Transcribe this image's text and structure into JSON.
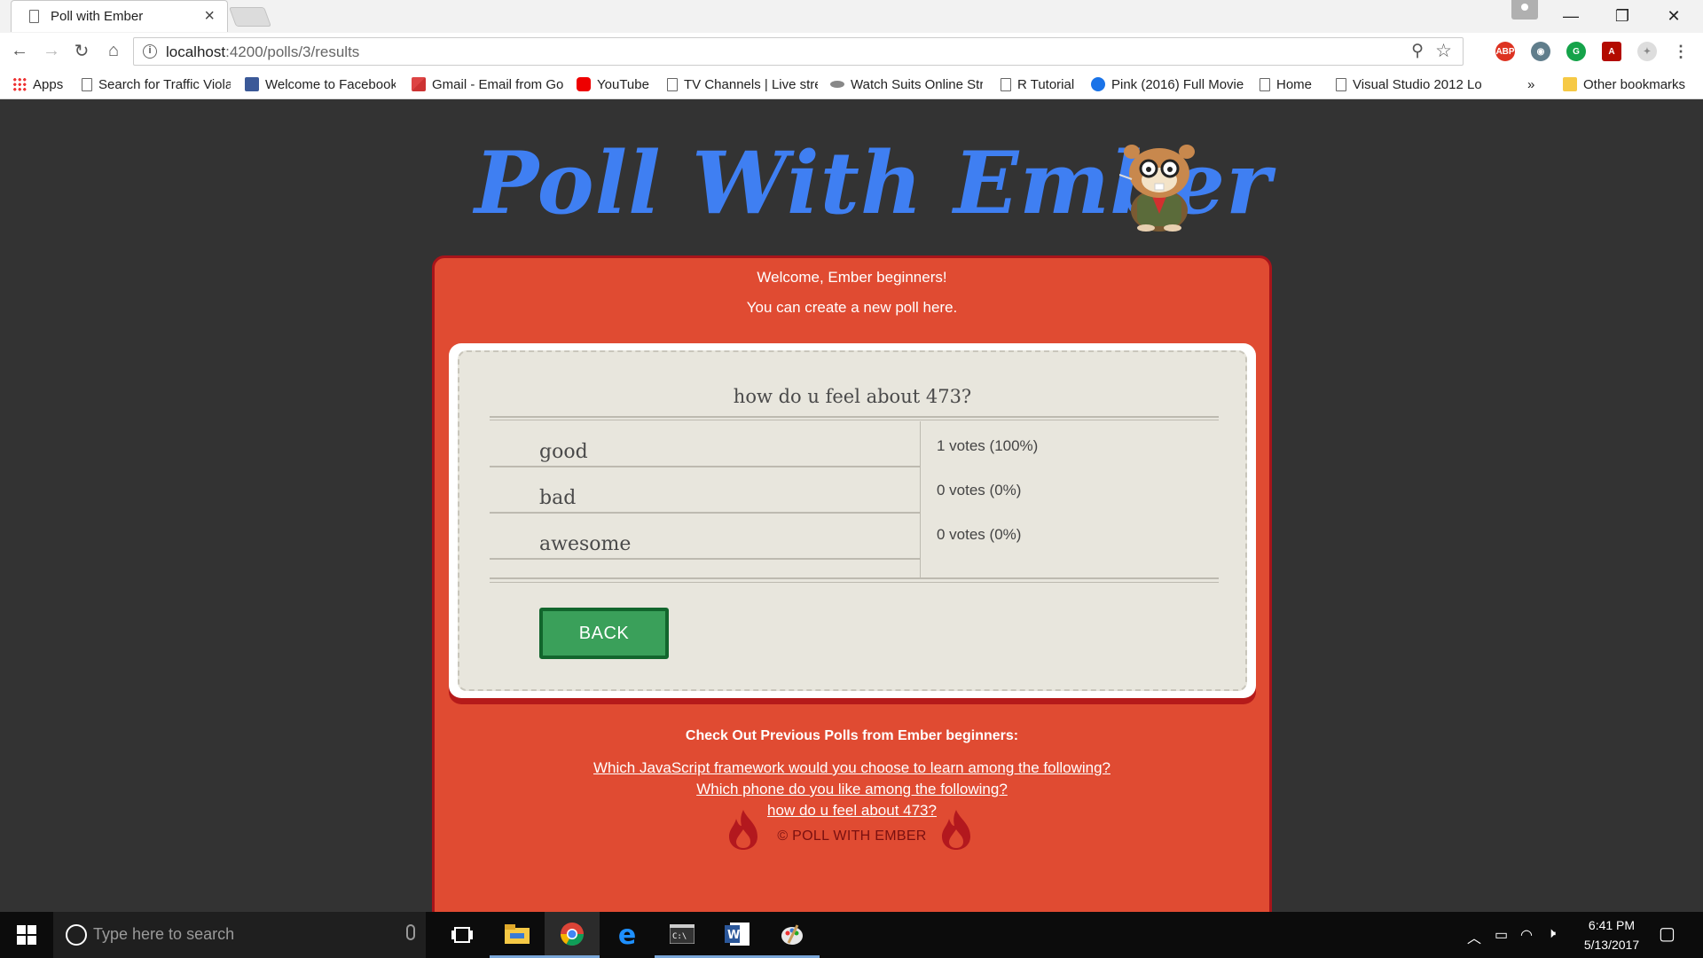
{
  "browser": {
    "tab_title": "Poll with Ember",
    "tab_close": "×",
    "window_minimize": "—",
    "window_restore": "❐",
    "window_close": "✕",
    "url_host": "localhost",
    "url_rest": ":4200/polls/3/results",
    "info_icon": "i",
    "bookmarks": [
      {
        "label": "Apps",
        "icon": "apps-icon"
      },
      {
        "label": "Search for Traffic Viola",
        "icon": "page-icon"
      },
      {
        "label": "Welcome to Facebook",
        "icon": "facebook-icon"
      },
      {
        "label": "Gmail - Email from Go",
        "icon": "gmail-icon"
      },
      {
        "label": "YouTube",
        "icon": "youtube-icon"
      },
      {
        "label": "TV Channels | Live stre",
        "icon": "page-icon"
      },
      {
        "label": "Watch Suits Online Str",
        "icon": "page-icon"
      },
      {
        "label": "R Tutorial",
        "icon": "page-icon"
      },
      {
        "label": "Pink (2016) Full Movie",
        "icon": "play-icon"
      },
      {
        "label": "Home",
        "icon": "page-icon"
      },
      {
        "label": "Visual Studio 2012 Lo",
        "icon": "page-icon"
      }
    ],
    "bookmarks_overflow": "»",
    "other_bookmarks": "Other bookmarks"
  },
  "page": {
    "logo_text": "Poll With Ember",
    "welcome_line1": "Welcome, Ember beginners!",
    "welcome_line2": "You can create a new poll here.",
    "poll": {
      "question": "how do u feel about 473?",
      "options": [
        {
          "label": "good",
          "result": "1 votes (100%)"
        },
        {
          "label": "bad",
          "result": "0 votes (0%)"
        },
        {
          "label": "awesome",
          "result": "0 votes (0%)"
        }
      ],
      "back_label": "BACK"
    },
    "previous_title": "Check Out Previous Polls from Ember beginners:",
    "previous_polls": [
      "Which JavaScript framework would you choose to learn among the following?",
      "Which phone do you like among the following?",
      "how do u feel about 473?"
    ],
    "footer": "© POLL WITH EMBER"
  },
  "taskbar": {
    "search_placeholder": "Type here to search",
    "time": "6:41 PM",
    "date": "5/13/2017"
  },
  "colors": {
    "card_bg": "#e04b32",
    "logo_blue": "#3f7ff2",
    "back_green": "#3aa05a",
    "page_bg": "#333333"
  }
}
